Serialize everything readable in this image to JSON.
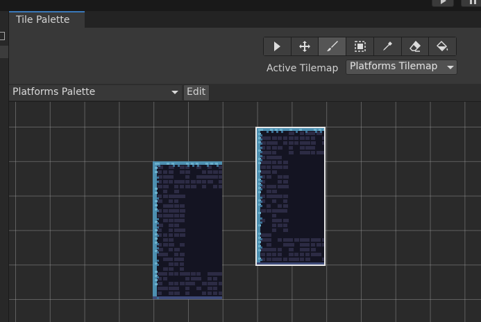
{
  "window": {
    "tab_title": "Tile Palette"
  },
  "toolbar": {
    "tools": [
      {
        "name": "select",
        "icon": "arrow-cursor-icon",
        "active": false
      },
      {
        "name": "move",
        "icon": "move-arrows-icon",
        "active": false
      },
      {
        "name": "paint",
        "icon": "brush-icon",
        "active": true
      },
      {
        "name": "box-fill",
        "icon": "box-select-icon",
        "active": false
      },
      {
        "name": "pick",
        "icon": "eyedropper-icon",
        "active": false
      },
      {
        "name": "erase",
        "icon": "eraser-icon",
        "active": false
      },
      {
        "name": "fill",
        "icon": "paint-bucket-icon",
        "active": false
      }
    ],
    "active_tilemap_label": "Active Tilemap",
    "active_tilemap_value": "Platforms Tilemap"
  },
  "palette": {
    "selected": "Platforms Palette",
    "edit_label": "Edit"
  },
  "colors": {
    "accent": "#3a79bb",
    "tile_border": "#4d8fb0",
    "tile_fill": "#141422",
    "brick": "#2c2b44"
  }
}
